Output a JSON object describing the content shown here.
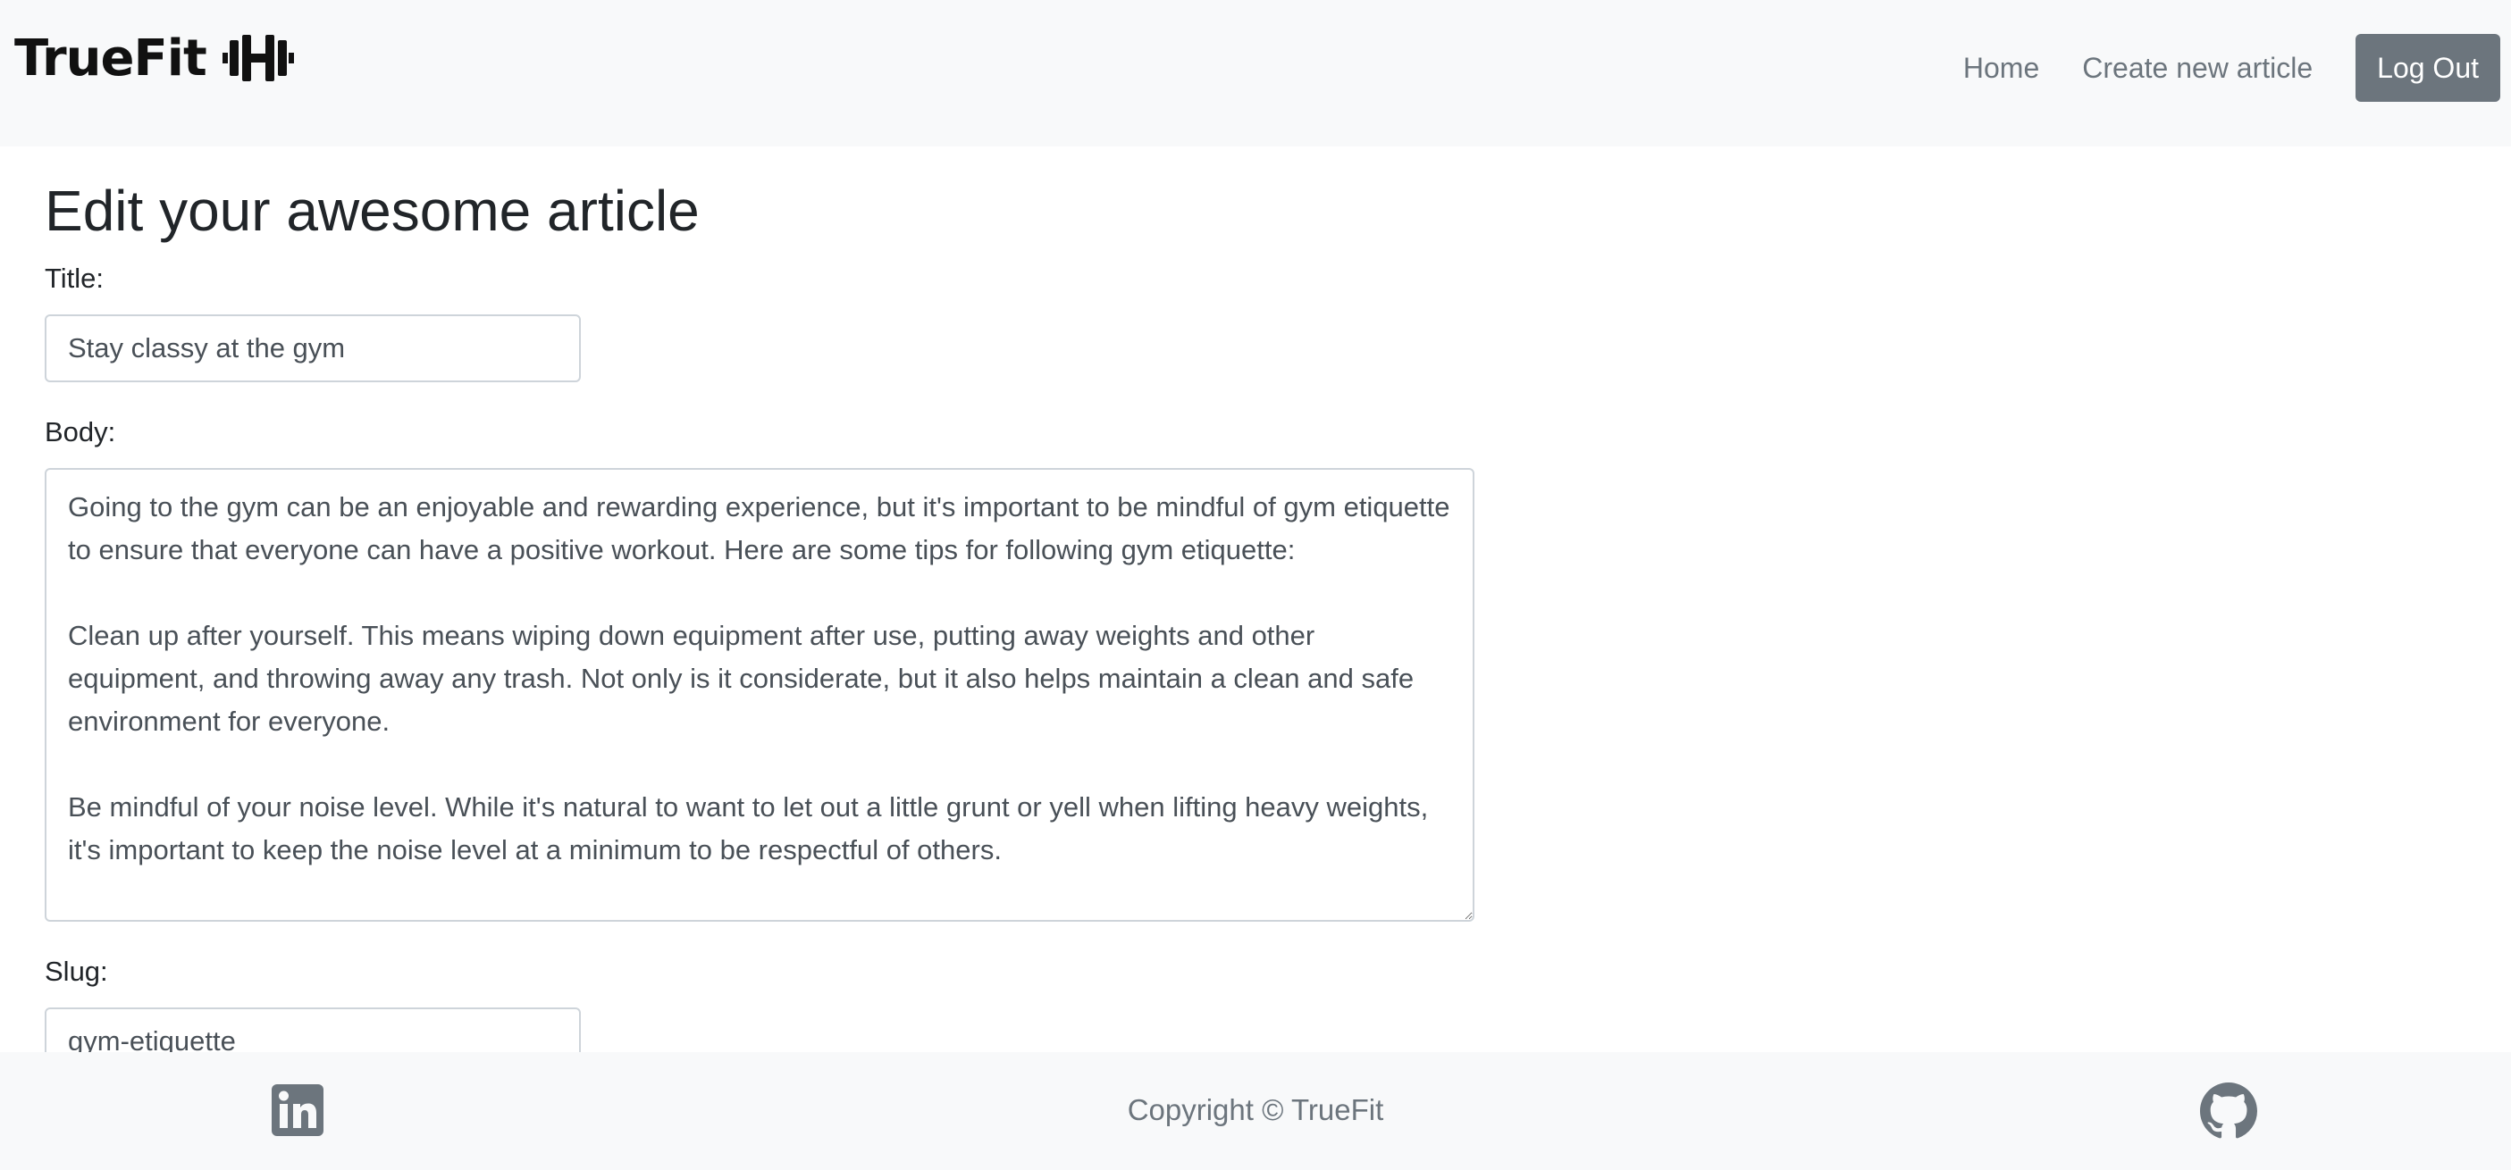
{
  "navbar": {
    "brand_text": "TrueFit",
    "brand_icon": "dumbbell-icon",
    "links": [
      {
        "label": "Home"
      },
      {
        "label": "Create new article"
      }
    ],
    "logout_label": "Log Out"
  },
  "main": {
    "heading": "Edit your awesome article",
    "title_label": "Title:",
    "title_value": "Stay classy at the gym",
    "body_label": "Body:",
    "body_value": "Going to the gym can be an enjoyable and rewarding experience, but it's important to be mindful of gym etiquette to ensure that everyone can have a positive workout. Here are some tips for following gym etiquette:\n\nClean up after yourself. This means wiping down equipment after use, putting away weights and other equipment, and throwing away any trash. Not only is it considerate, but it also helps maintain a clean and safe environment for everyone.\n\nBe mindful of your noise level. While it's natural to want to let out a little grunt or yell when lifting heavy weights, it's important to keep the noise level at a minimum to be respectful of others.",
    "slug_label": "Slug:",
    "slug_value": "gym-etiquette"
  },
  "footer": {
    "copyright": "Copyright © TrueFit",
    "left_icon": "linkedin-icon",
    "right_icon": "github-icon"
  },
  "colors": {
    "navbar_bg": "#f8f9fa",
    "button_bg": "#6c757d",
    "muted_text": "#6c757d",
    "input_border": "#ced4da"
  }
}
